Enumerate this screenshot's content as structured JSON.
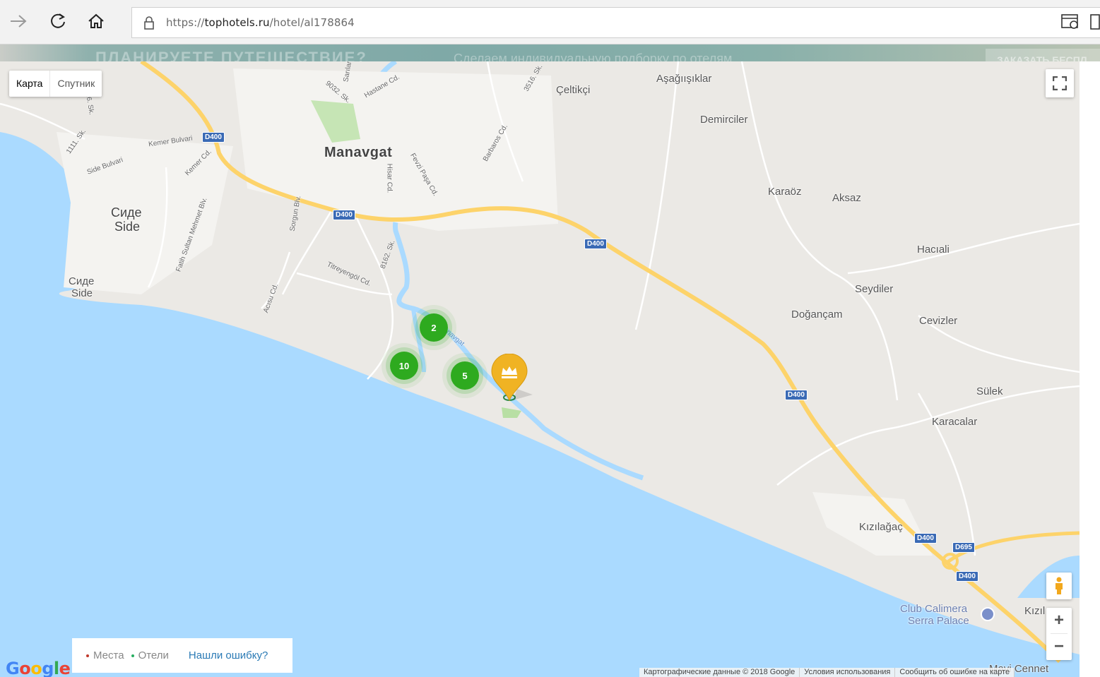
{
  "browser": {
    "url_prefix": "https://",
    "url_domain": "tophotels.ru",
    "url_path": "/hotel/al178864"
  },
  "banner": {
    "headline": "ПЛАНИРУЕТЕ ПУТЕШЕСТВИЕ?",
    "subline": "Сделаем индивидуальную подборку по отелям",
    "cta": "ЗАКАЗАТЬ БЕСПЛ"
  },
  "map": {
    "type_controls": {
      "map": "Карта",
      "satellite": "Спутник"
    },
    "places": [
      {
        "name": "Manavgat",
        "style": "big"
      },
      {
        "name": "Çeltikçi"
      },
      {
        "name": "Aşağıışıklar"
      },
      {
        "name": "Demirciler"
      },
      {
        "name": "Karaöz"
      },
      {
        "name": "Aksaz"
      },
      {
        "name": "Hacıali"
      },
      {
        "name": "Seydiler"
      },
      {
        "name": "Doğançam"
      },
      {
        "name": "Cevizler"
      },
      {
        "name": "Sülek"
      },
      {
        "name": "Karacalar"
      },
      {
        "name": "Kızılağaç"
      },
      {
        "name": "Сиде",
        "style": "mid"
      },
      {
        "name": "Side",
        "style": "mid"
      },
      {
        "name": "Сиде"
      },
      {
        "name": "Side"
      },
      {
        "name": "Club Calimera"
      },
      {
        "name": "Serra Palace"
      },
      {
        "name": "Kızıl"
      },
      {
        "name": "Mavi Cennet"
      }
    ],
    "streets": [
      "9032. Sk.",
      "Hastane Cd.",
      "3516. Sk.",
      "Kemer Bulvari",
      "1111. Sk.",
      "Side Bulvari",
      "Kemer Cd.",
      "Hisar Cd.",
      "Fevzi Paşa Cd.",
      "Barbaros Cd.",
      "Sorgun Blv.",
      "Fatih Sultan Mehmet Blv.",
      "8162. Sk.",
      "Titreyengöl Cd.",
      "Acısu Cd.",
      "126. Sk.",
      "Manavgat",
      "Sarılar Cd."
    ],
    "road_shields": [
      "D400",
      "D400",
      "D400",
      "D400",
      "D400",
      "D695",
      "D400"
    ],
    "clusters": [
      "2",
      "10",
      "5"
    ],
    "legend": {
      "places": "Места",
      "hotels": "Отели",
      "report": "Нашли ошибку?",
      "places_color": "#c0392b",
      "hotels_color": "#27ae60"
    },
    "google_logo": "Google",
    "attribution": {
      "data": "Картографические данные © 2018 Google",
      "terms": "Условия использования",
      "report": "Сообщить об ошибке на карте"
    },
    "zoom": {
      "in": "+",
      "out": "−"
    },
    "colors": {
      "water": "#aadaff",
      "land": "#ebe9e5",
      "highway": "#fdd36a",
      "cluster": "#2eaa1f",
      "pin": "#f0b323"
    }
  }
}
